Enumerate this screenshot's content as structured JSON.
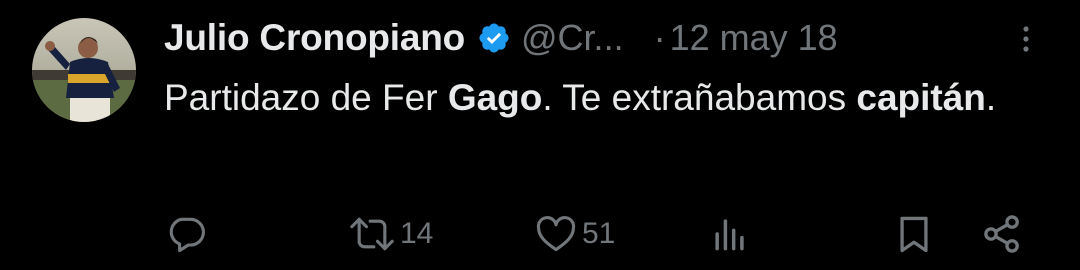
{
  "tweet": {
    "author_name": "Julio Cronopiano",
    "handle": "@Cr...",
    "separator": "·",
    "date": "12 may 18",
    "text_segments": [
      {
        "text": "Partidazo de Fer ",
        "bold": false
      },
      {
        "text": "Gago",
        "bold": true
      },
      {
        "text": ". Te extrañabamos ",
        "bold": false
      },
      {
        "text": "capitán",
        "bold": true
      },
      {
        "text": ".",
        "bold": false
      }
    ]
  },
  "actions": {
    "reply": {
      "icon": "reply-icon",
      "count": ""
    },
    "retweet": {
      "icon": "retweet-icon",
      "count": "14"
    },
    "like": {
      "icon": "heart-icon",
      "count": "51"
    },
    "views": {
      "icon": "views-chart-icon",
      "count": ""
    },
    "bookmark": {
      "icon": "bookmark-icon"
    },
    "share": {
      "icon": "share-icon"
    }
  },
  "colors": {
    "background": "#000000",
    "primary_text": "#e7e9ea",
    "secondary_text": "#71767b",
    "verified_badge": "#1d9bf0"
  }
}
